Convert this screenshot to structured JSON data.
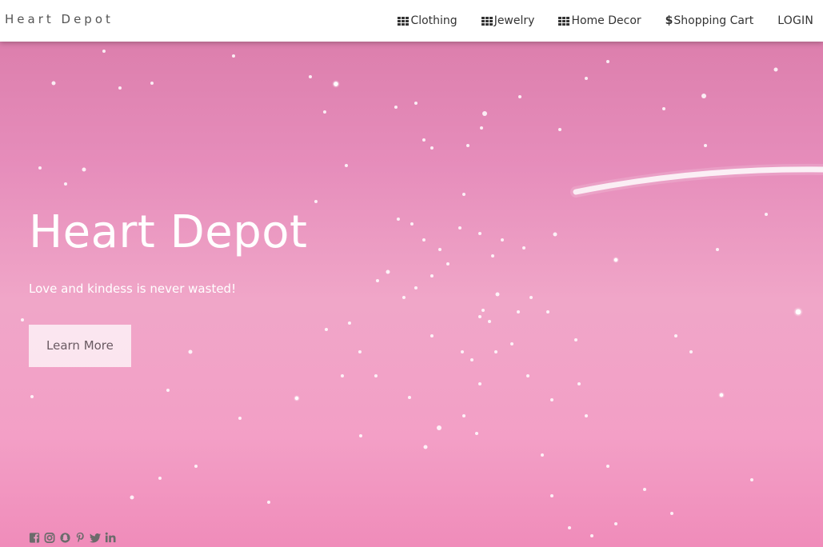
{
  "brand": "Heart Depot",
  "nav": {
    "items": [
      {
        "label": "Clothing",
        "icon": "grid-icon"
      },
      {
        "label": "Jewelry",
        "icon": "grid-icon"
      },
      {
        "label": "Home Decor",
        "icon": "grid-icon"
      },
      {
        "label": "Shopping Cart",
        "icon": "dollar-icon",
        "icon_glyph": "$"
      },
      {
        "label": "LOGIN"
      }
    ]
  },
  "hero": {
    "title": "Heart Depot",
    "subtitle": "Love and kindess is never wasted!",
    "button_label": "Learn More"
  },
  "social": [
    "facebook-icon",
    "instagram-icon",
    "snapchat-icon",
    "pinterest-icon",
    "twitter-icon",
    "linkedin-icon"
  ],
  "colors": {
    "navbar_bg": "#ffffff",
    "hero_bg": "#ec9cc3",
    "text_light": "#ffffff",
    "nav_text": "#333333",
    "icon_color": "#6b6b6b"
  }
}
